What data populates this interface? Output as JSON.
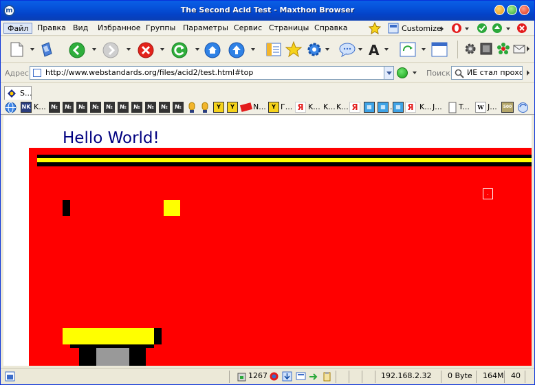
{
  "window": {
    "title": "The Second Acid Test - Maxthon Browser"
  },
  "menu": {
    "items": [
      "Файл",
      "Правка",
      "Вид",
      "Избранное",
      "Группы",
      "Параметры",
      "Сервис",
      "Страницы",
      "Справка"
    ],
    "customize_label": "Customize"
  },
  "address": {
    "label": "Адрес",
    "url": "http://www.webstandards.org/files/acid2/test.html#top",
    "search_label": "Поиск",
    "search_value": "ИЕ стал прохо..."
  },
  "tabs": [
    {
      "label": "S..."
    }
  ],
  "links": {
    "labels": [
      "K...",
      "N...",
      "Г...",
      "K...",
      "K...",
      "K...",
      "...",
      "K...",
      "J...",
      "T...",
      "J..."
    ]
  },
  "content": {
    "heading": "Hello World!"
  },
  "status": {
    "count": "1267",
    "ip": "192.168.2.32",
    "bytes": "0 Byte",
    "memory": "164M",
    "number": "40"
  },
  "colors": {
    "acid_red": "#ff0000",
    "acid_yellow": "#ffff00",
    "acid_black": "#000000",
    "heading_navy": "#000080"
  }
}
